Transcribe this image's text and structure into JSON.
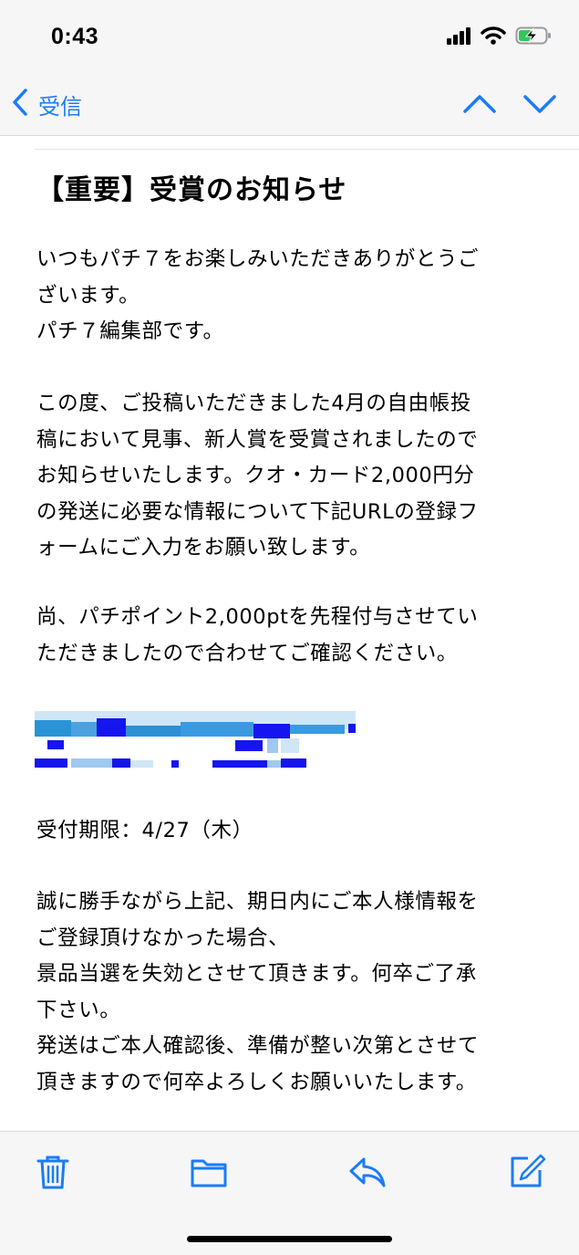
{
  "status_bar": {
    "time": "0:43",
    "icons": [
      "cellular-signal-icon",
      "wifi-icon",
      "battery-charging-icon"
    ]
  },
  "nav": {
    "back_label": "受信",
    "icons": [
      "chevron-left-icon",
      "chevron-up-icon",
      "chevron-down-icon"
    ]
  },
  "email": {
    "subject": "【重要】受賞のお知らせ",
    "paragraphs": [
      "いつもパチ７をお楽しみいただきありがとうございます。\nパチ７編集部です。",
      "この度、ご投稿いただきました4月の自由帳投稿において見事、新人賞を受賞されましたのでお知らせいたします。クオ・カード2,000円分の発送に必要な情報について下記URLの登録フォームにご入力をお願い致します。",
      "尚、パチポイント2,000ptを先程付与させていただきましたので合わせてご確認ください。",
      "受付期限：4/27（木）",
      "誠に勝手ながら上記、期日内にご本人様情報をご登録頂けなかった場合、\n景品当選を失効とさせて頂きます。何卒ご了承下さい。\n発送はご本人確認後、準備が整い次第とさせて頂きますので何卒よろしくお願いいたします。"
    ]
  },
  "toolbar": {
    "icons": [
      "trash-icon",
      "folder-icon",
      "reply-icon",
      "compose-icon"
    ]
  },
  "colors": {
    "accent": "#1a7cf5",
    "bar_background": "#f6f6f7"
  }
}
